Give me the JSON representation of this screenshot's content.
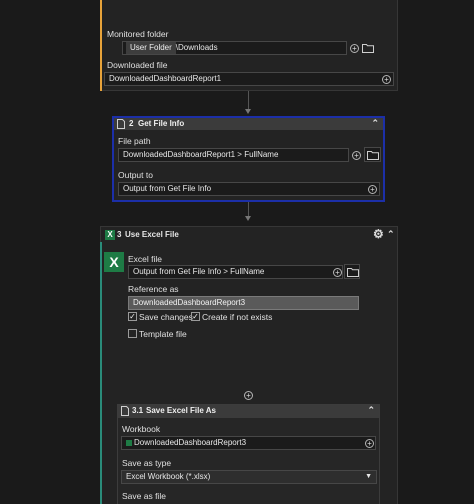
{
  "step1": {
    "monitored_folder_label": "Monitored folder",
    "folder_chip": "User Folder",
    "folder_path": "\\Downloads",
    "downloaded_file_label": "Downloaded file",
    "downloaded_file_value": "DownloadedDashboardReport1"
  },
  "step2": {
    "number": "2",
    "title": "Get File Info",
    "file_path_label": "File path",
    "file_path_value": "DownloadedDashboardReport1 > FullName",
    "output_label": "Output to",
    "output_value": "Output from Get File Info"
  },
  "step3": {
    "number": "3",
    "title": "Use Excel File",
    "excel_file_label": "Excel file",
    "excel_file_value": "Output from Get File Info > FullName",
    "reference_label": "Reference as",
    "reference_value": "DownloadedDashboardReport3",
    "save_changes_label": "Save changes",
    "save_changes_checked": true,
    "create_if_not_exists_label": "Create if not exists",
    "create_if_not_exists_checked": true,
    "template_file_label": "Template file",
    "template_file_checked": false
  },
  "step31": {
    "number": "3.1",
    "title": "Save Excel File As",
    "workbook_label": "Workbook",
    "workbook_value": "DownloadedDashboardReport3",
    "save_as_type_label": "Save as type",
    "save_as_type_value": "Excel Workbook (*.xlsx)",
    "save_as_file_label": "Save as file"
  },
  "colors": {
    "selected_border": "#1c2fa8",
    "accent_orange": "#e8a33a",
    "excel_green": "#1e7b45",
    "teal_line": "#2a8c7a"
  }
}
